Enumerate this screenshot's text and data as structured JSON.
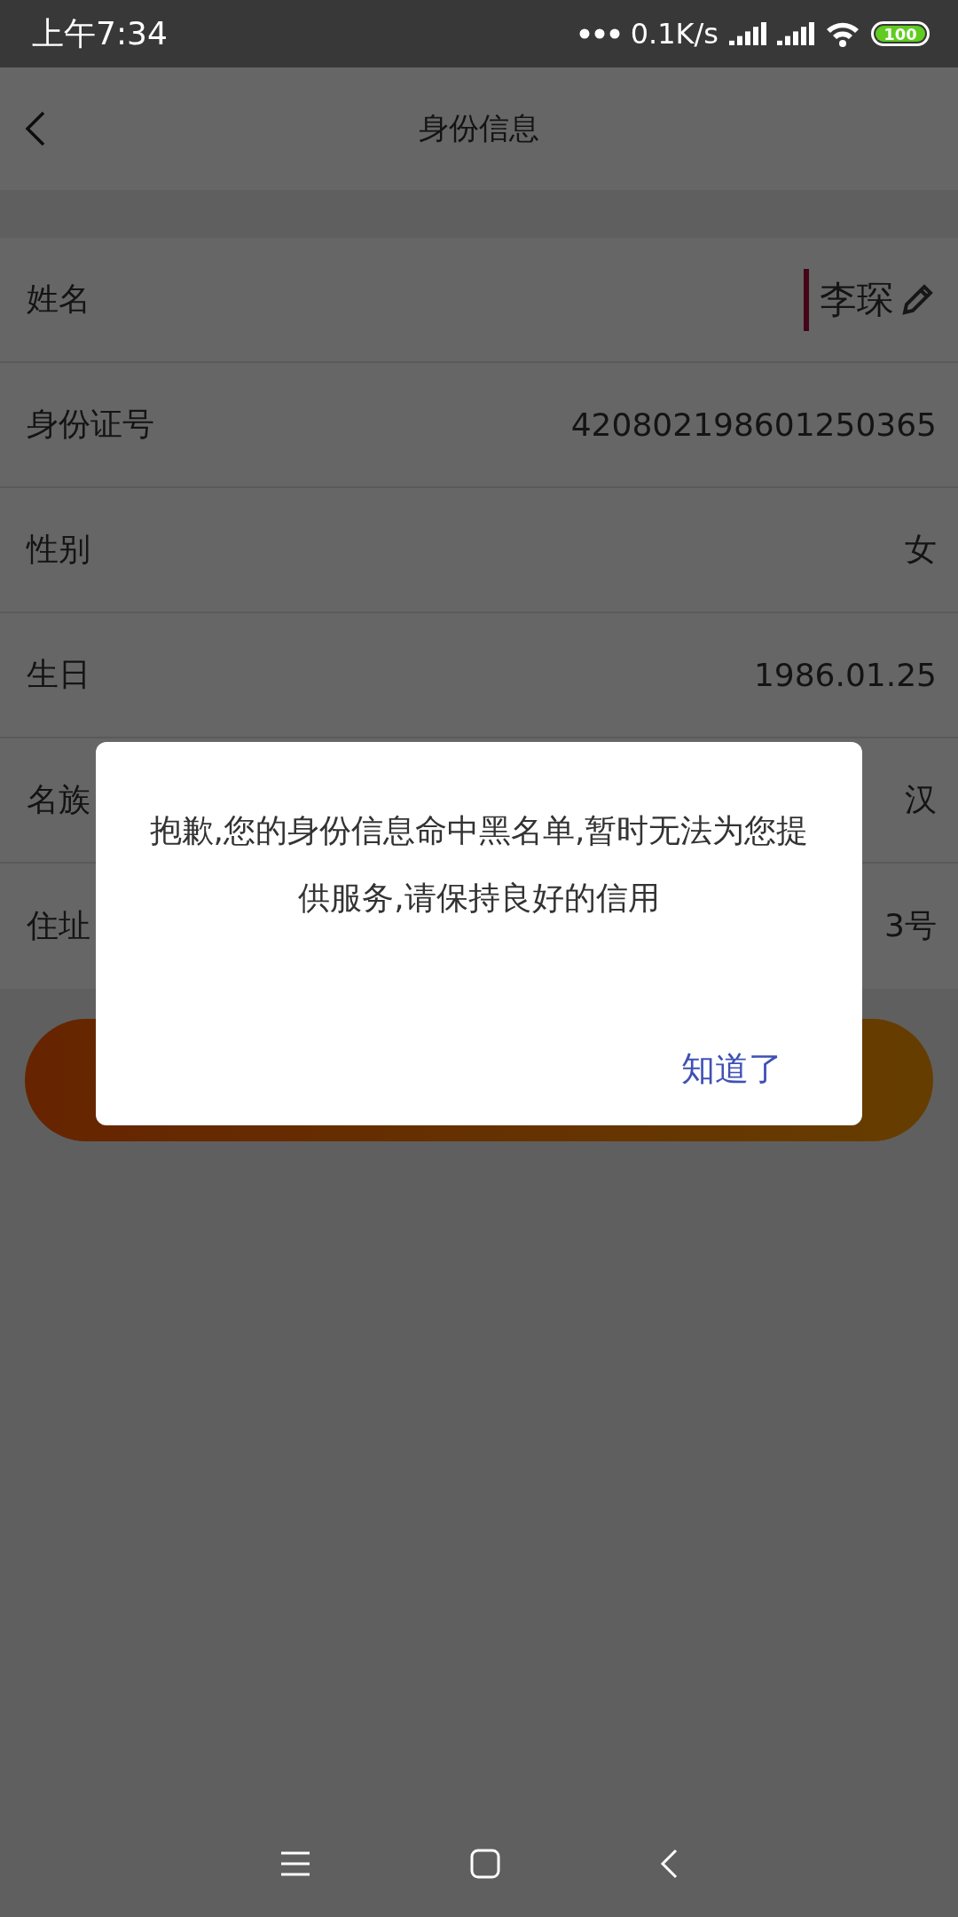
{
  "status_bar": {
    "time": "上午7:34",
    "network_speed": "0.1K/s",
    "battery": "100"
  },
  "header": {
    "title": "身份信息"
  },
  "fields": [
    {
      "label": "姓名",
      "value": "李琛",
      "kind": "input"
    },
    {
      "label": "身份证号",
      "value": "420802198601250365",
      "kind": "text"
    },
    {
      "label": "性别",
      "value": "女",
      "kind": "text"
    },
    {
      "label": "生日",
      "value": "1986.01.25",
      "kind": "text"
    },
    {
      "label": "名族",
      "value": "汉",
      "kind": "text"
    },
    {
      "label": "住址",
      "value": "3号",
      "kind": "text"
    }
  ],
  "dialog": {
    "message": "抱歉,您的身份信息命中黑名单,暂时无法为您提供服务,请保持良好的信用",
    "button": "知道了"
  }
}
